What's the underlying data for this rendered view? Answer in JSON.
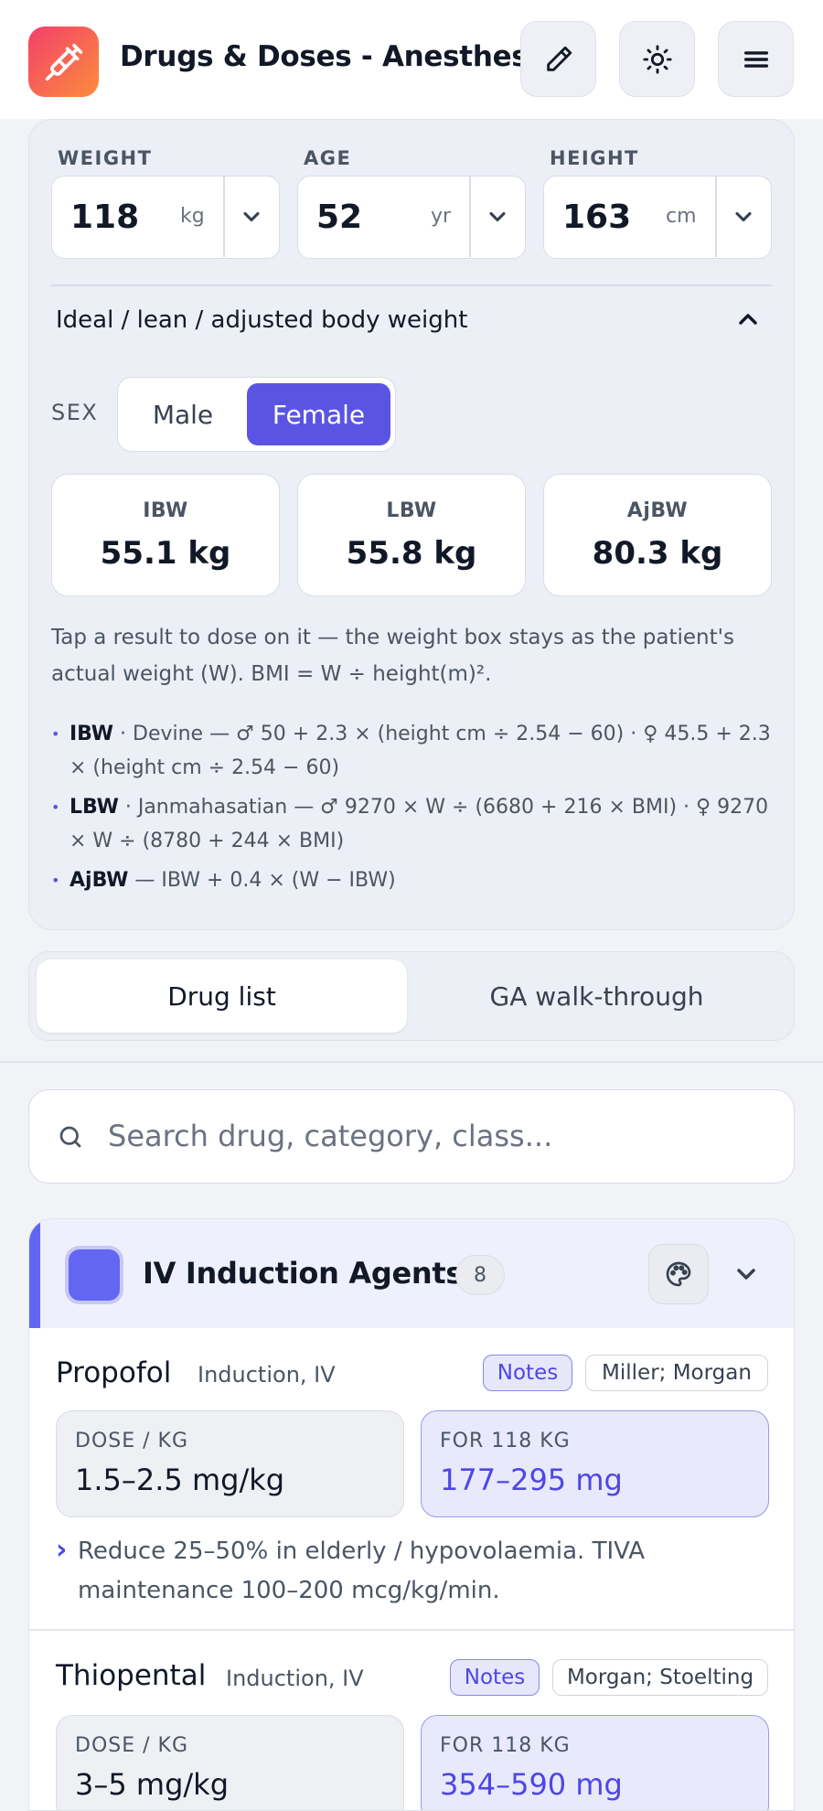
{
  "app": {
    "title": "Drugs & Doses - Anesthesia"
  },
  "patient": {
    "weight": {
      "label": "WEIGHT",
      "value": "118",
      "unit": "kg"
    },
    "age": {
      "label": "AGE",
      "value": "52",
      "unit": "yr"
    },
    "height": {
      "label": "HEIGHT",
      "value": "163",
      "unit": "cm"
    }
  },
  "body_weight": {
    "expander_label": "Ideal / lean / adjusted body weight",
    "sex_label": "SEX",
    "sex_options": [
      "Male",
      "Female"
    ],
    "sex_selected": "Female",
    "cards": [
      {
        "key": "IBW",
        "value": "55.1 kg"
      },
      {
        "key": "LBW",
        "value": "55.8 kg"
      },
      {
        "key": "AjBW",
        "value": "80.3 kg"
      }
    ],
    "hint": "Tap a result to dose on it — the weight box stays as the patient's actual weight (W). BMI = W ÷ height(m)².",
    "formulas": [
      {
        "name": "IBW",
        "text": " · Devine — ♂ 50 + 2.3 × (height cm ÷ 2.54 − 60)  ·  ♀ 45.5 + 2.3 × (height cm ÷ 2.54 − 60)"
      },
      {
        "name": "LBW",
        "text": " · Janmahasatian — ♂ 9270 × W ÷ (6680 + 216 × BMI)  ·  ♀ 9270 × W ÷ (8780 + 244 × BMI)"
      },
      {
        "name": "AjBW",
        "text": " — IBW + 0.4 × (W − IBW)"
      }
    ]
  },
  "tabs": {
    "drug_list": "Drug list",
    "ga_walkthrough": "GA walk-through",
    "selected": "Drug list"
  },
  "search": {
    "placeholder": "Search drug, category, class..."
  },
  "category": {
    "title": "IV Induction Agents",
    "count": "8",
    "color": "#6366f1",
    "drugs": [
      {
        "name": "Propofol",
        "route": "Induction, IV",
        "notes_label": "Notes",
        "refs": "Miller; Morgan",
        "dose_label": "DOSE / KG",
        "dose": "1.5–2.5 mg/kg",
        "for_label": "FOR 118 KG",
        "total": "177–295 mg",
        "note": "Reduce 25–50% in elderly / hypovolaemia. TIVA maintenance 100–200 mcg/kg/min."
      },
      {
        "name": "Thiopental",
        "route": "Induction, IV",
        "notes_label": "Notes",
        "refs": "Morgan; Stoelting",
        "dose_label": "DOSE / KG",
        "dose": "3–5 mg/kg",
        "for_label": "FOR 118 KG",
        "total": "354–590 mg"
      }
    ]
  },
  "colors": {
    "accent": "#5b54e3",
    "app_icon_from": "#f43f6b",
    "app_icon_to": "#fb8c3c"
  },
  "icons": [
    "syringe-icon",
    "pencil-icon",
    "sun-icon",
    "menu-icon",
    "chevron-down-icon",
    "chevron-up-icon",
    "search-icon",
    "palette-icon"
  ]
}
